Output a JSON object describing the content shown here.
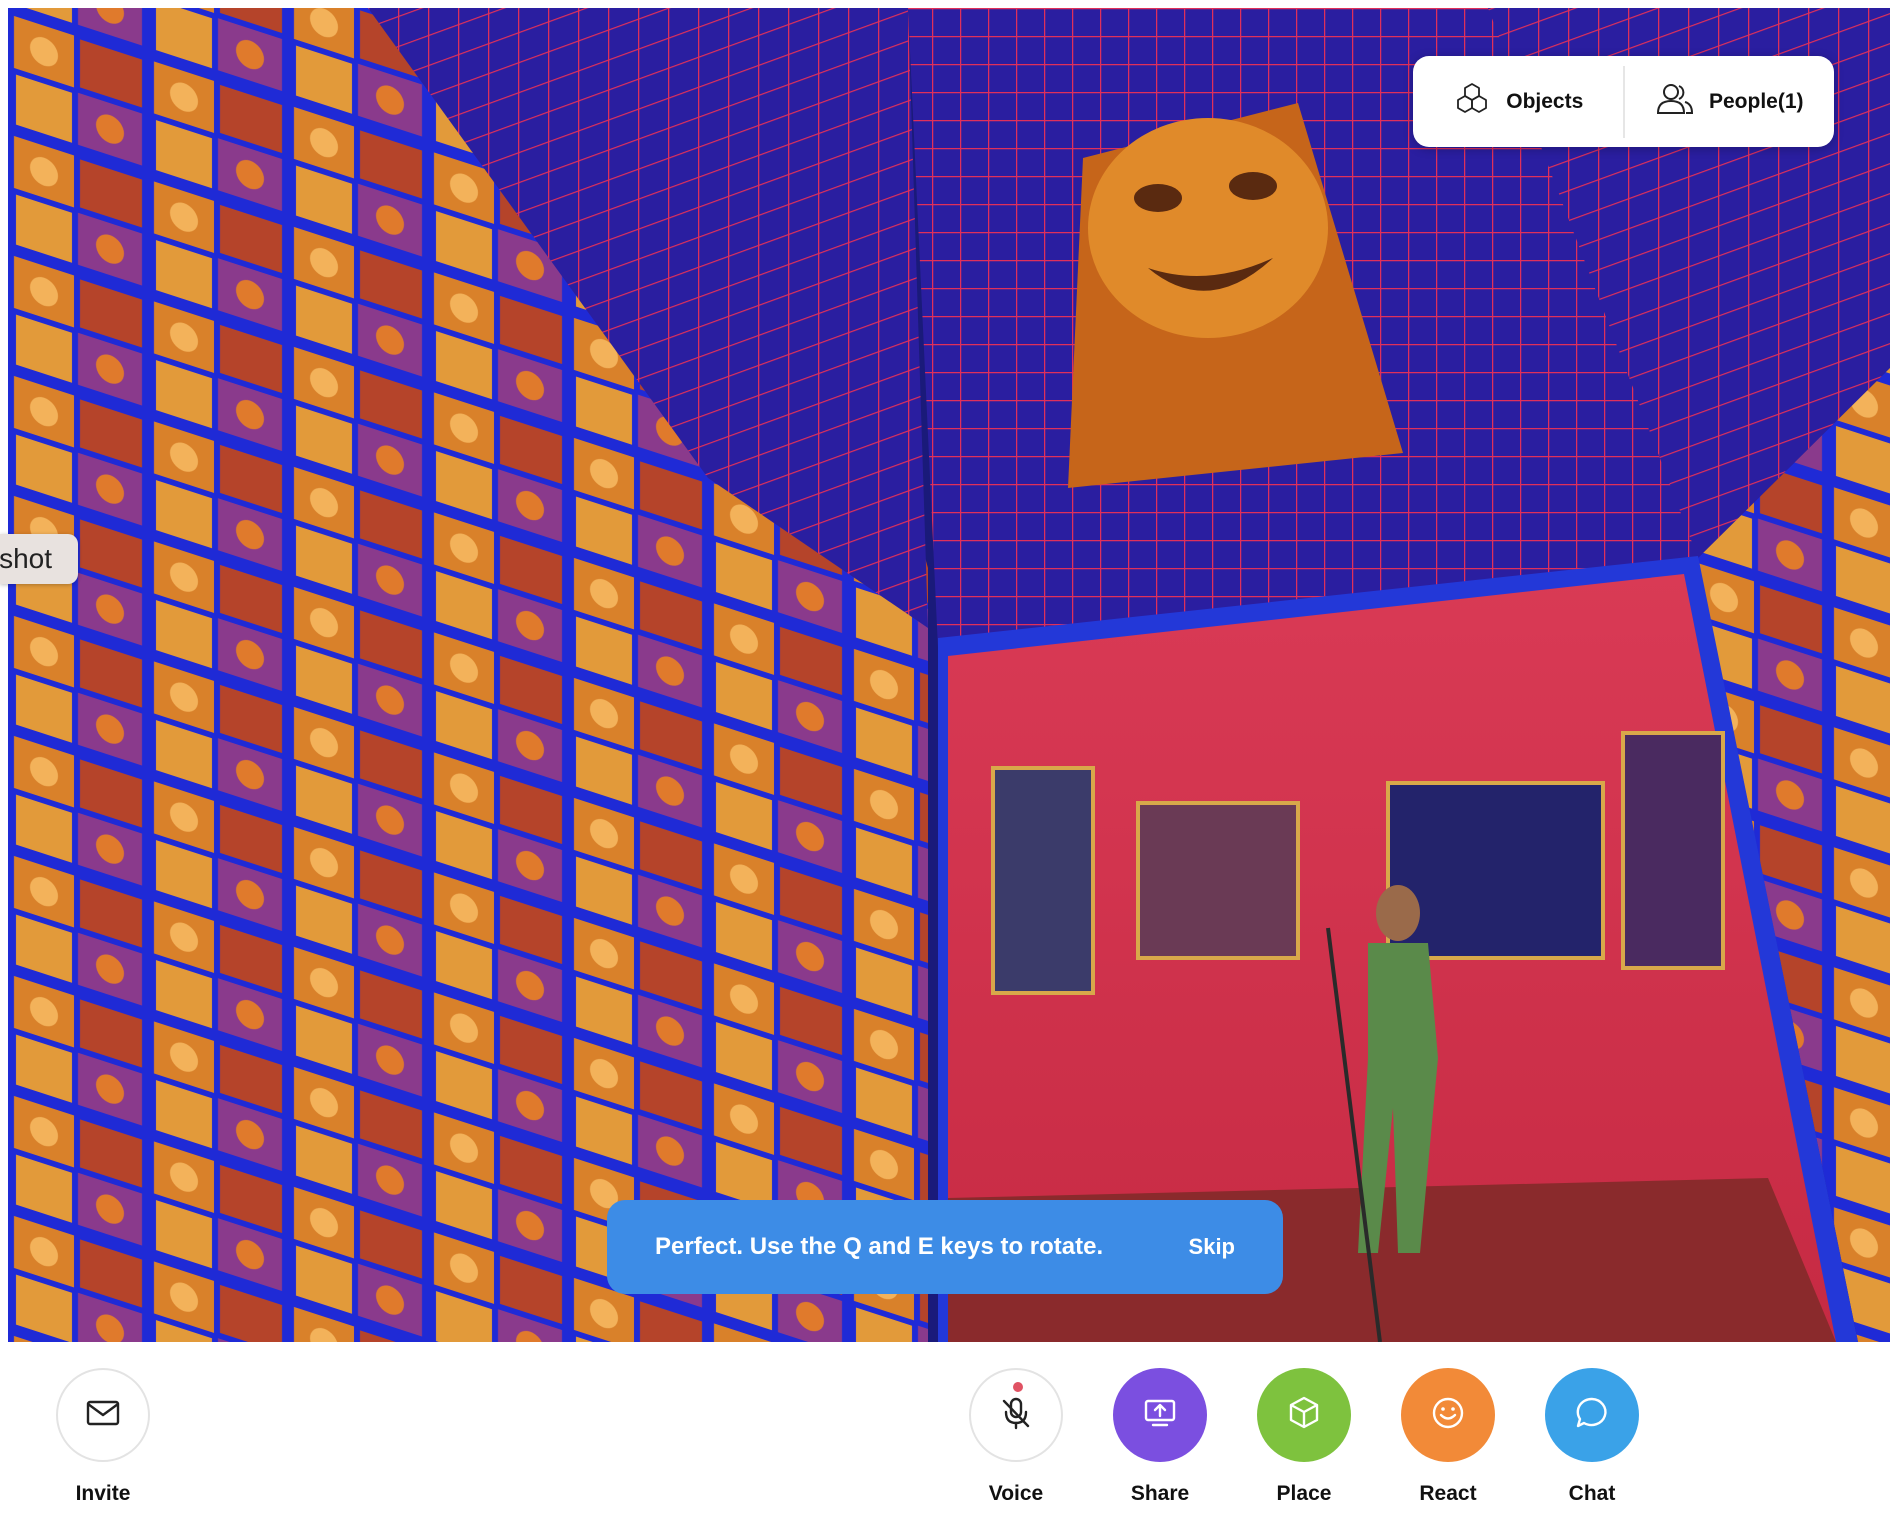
{
  "top_panel": {
    "objects_label": "Objects",
    "people_label": "People(1)"
  },
  "side_tab": {
    "label": "shot"
  },
  "tip": {
    "text": "Perfect. Use the Q and E keys to rotate.",
    "skip_label": "Skip"
  },
  "bottom_bar": {
    "invite_label": "Invite",
    "voice_label": "Voice",
    "share_label": "Share",
    "place_label": "Place",
    "react_label": "React",
    "chat_label": "Chat"
  },
  "colors": {
    "share": "#7b4fe0",
    "place": "#7ec23e",
    "react": "#f28a38",
    "chat": "#3aa2e8",
    "tip_banner": "#3d8ce6",
    "voice_dot": "#e05263"
  },
  "icons": {
    "objects": "cubes-icon",
    "people": "people-icon",
    "invite": "envelope-icon",
    "voice": "microphone-muted-icon",
    "share": "screen-share-icon",
    "place": "cube-icon",
    "react": "smiley-icon",
    "chat": "chat-bubble-icon"
  }
}
